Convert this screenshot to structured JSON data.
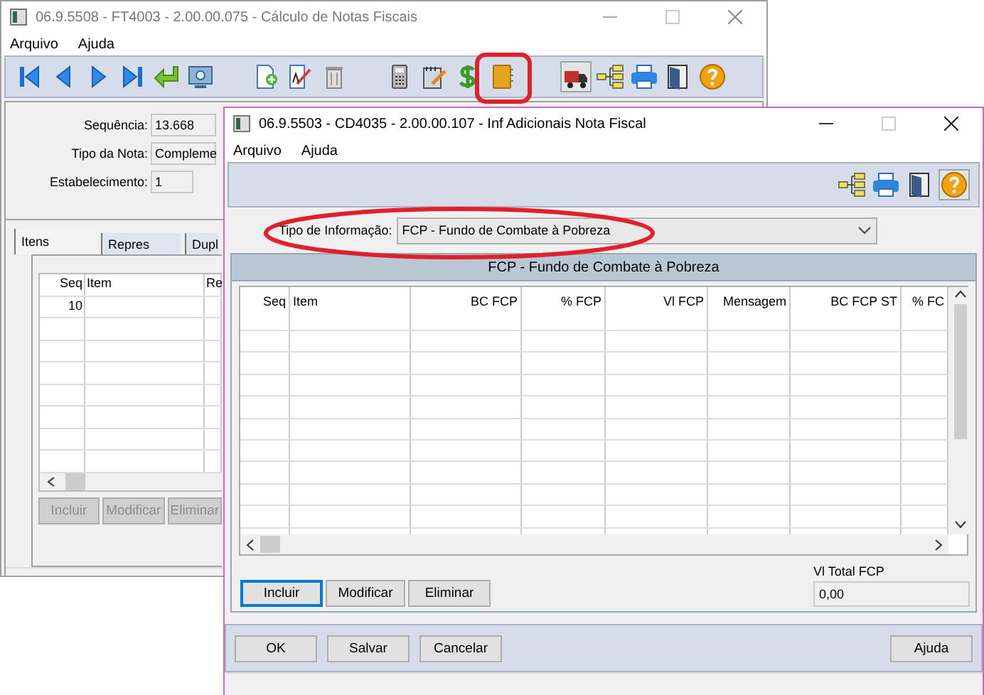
{
  "back_window": {
    "title": "06.9.5508 - FT4003 - 2.00.00.075 - Cálculo de Notas Fiscais",
    "menu": [
      "Arquivo",
      "Ajuda"
    ],
    "form": [
      {
        "label": "Sequência:",
        "value": "13.668"
      },
      {
        "label": "Tipo da Nota:",
        "value": "Compleme"
      },
      {
        "label": "Estabelecimento:",
        "value": "1"
      }
    ],
    "tabs": [
      {
        "label": "Itens",
        "selected": true
      },
      {
        "label": "Repres",
        "selected": false
      },
      {
        "label": "Dupl",
        "selected": false
      }
    ],
    "grid": {
      "columns": [
        "Seq",
        "Item",
        "Re"
      ],
      "rows": [
        [
          "10",
          ""
        ]
      ]
    },
    "buttons": [
      {
        "label": "Incluir",
        "disabled": true
      },
      {
        "label": "Modificar",
        "disabled": true
      },
      {
        "label": "Eliminar",
        "disabled": true
      }
    ]
  },
  "front_window": {
    "title": "06.9.5503 - CD4035 - 2.00.00.107 - Inf Adicionais Nota Fiscal",
    "menu": [
      "Arquivo",
      "Ajuda"
    ],
    "info_type": {
      "label": "Tipo de Informação:",
      "value": "FCP - Fundo de Combate à Pobreza"
    },
    "group_title": "FCP - Fundo de Combate à Pobreza",
    "table": {
      "columns": [
        "Seq",
        "Item",
        "BC FCP",
        "% FCP",
        "Vl FCP",
        "Mensagem",
        "BC FCP ST",
        "% FC"
      ]
    },
    "buttons": [
      {
        "label": "Incluir",
        "focused": true
      },
      {
        "label": "Modificar",
        "focused": false
      },
      {
        "label": "Eliminar",
        "focused": false
      }
    ],
    "total": {
      "label": "Vl Total FCP",
      "value": "0,00"
    },
    "footer_buttons": [
      "OK",
      "Salvar",
      "Cancelar"
    ],
    "help_button": "Ajuda"
  }
}
